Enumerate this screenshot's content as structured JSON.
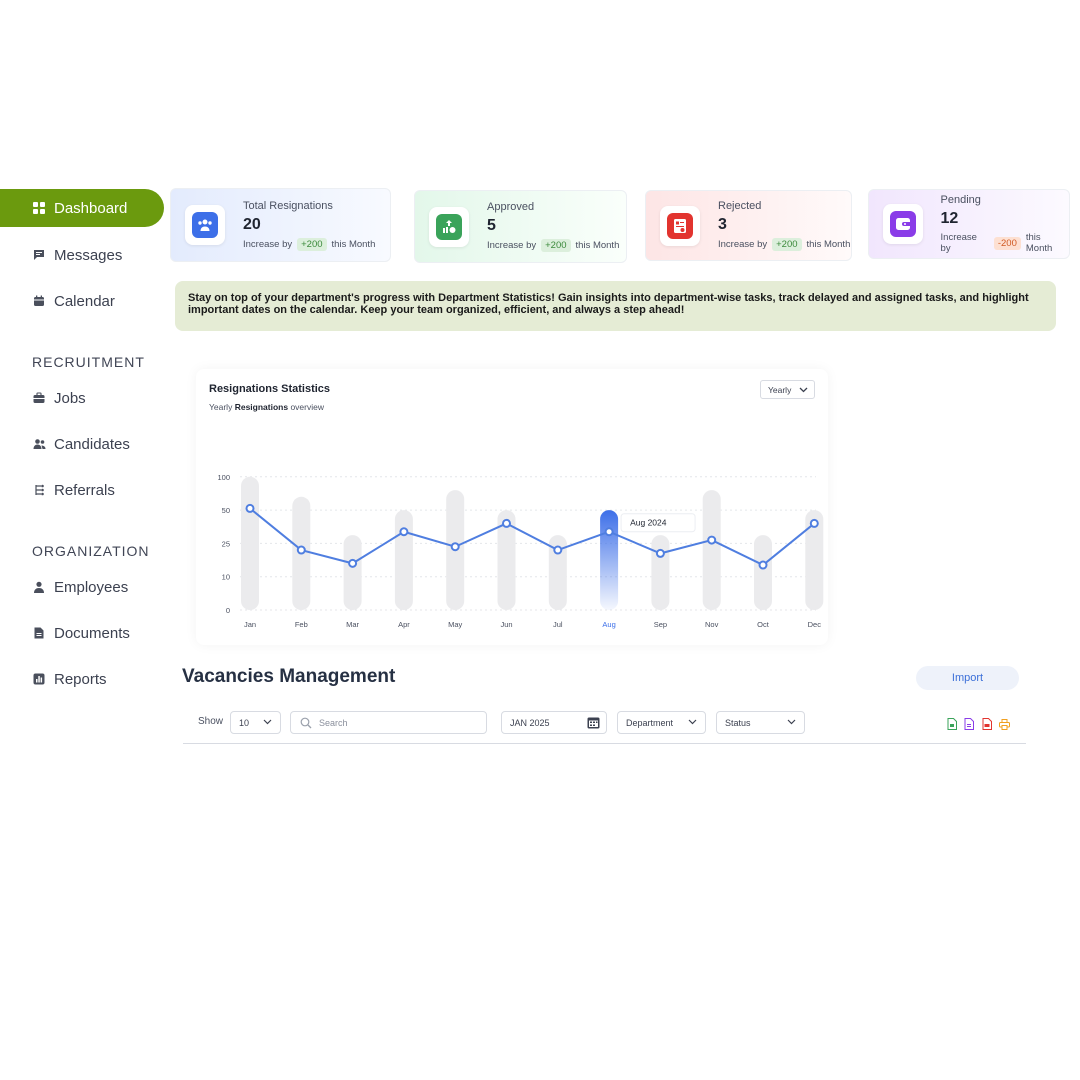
{
  "sidebar": {
    "items": [
      {
        "label": "Dashboard",
        "icon": "grid-icon"
      },
      {
        "label": "Messages",
        "icon": "message-icon"
      },
      {
        "label": "Calendar",
        "icon": "calendar-icon"
      }
    ],
    "recruitment_title": "RECRUITMENT",
    "recruitment_items": [
      {
        "label": "Jobs",
        "icon": "briefcase-icon"
      },
      {
        "label": "Candidates",
        "icon": "users-icon"
      },
      {
        "label": "Referrals",
        "icon": "referral-icon"
      }
    ],
    "organization_title": "ORGANIZATION",
    "organization_items": [
      {
        "label": "Employees",
        "icon": "user-icon"
      },
      {
        "label": "Documents",
        "icon": "document-icon"
      },
      {
        "label": "Reports",
        "icon": "report-icon"
      }
    ]
  },
  "stats": [
    {
      "label": "Total Resignations",
      "value": "20",
      "prefix": "Increase by",
      "delta": "+200",
      "suffix": "this Month",
      "color": "#3d6fe8"
    },
    {
      "label": "Approved",
      "value": "5",
      "prefix": "Increase by",
      "delta": "+200",
      "suffix": "this Month",
      "color": "#3aa35a"
    },
    {
      "label": "Rejected",
      "value": "3",
      "prefix": "Increase by",
      "delta": "+200",
      "suffix": "this Month",
      "color": "#e2342f"
    },
    {
      "label": "Pending",
      "value": "12",
      "prefix": "Increase by",
      "delta": "-200",
      "suffix": "this Month",
      "color": "#8a3ce8"
    }
  ],
  "banner": "Stay on top of your department's progress with Department Statistics! Gain insights into department-wise tasks, track delayed and assigned tasks, and highlight important dates on the calendar. Keep your team organized, efficient, and always a step ahead!",
  "chart_panel": {
    "title": "Resignations Statistics",
    "sub_prefix": "Yearly",
    "sub_bold": "Resignations",
    "sub_suffix": "overview",
    "period": "Yearly",
    "tooltip": "Aug 2024"
  },
  "chart_data": {
    "type": "bar",
    "categories": [
      "Jan",
      "Feb",
      "Mar",
      "Apr",
      "May",
      "Jun",
      "Jul",
      "Aug",
      "Sep",
      "Nov",
      "Oct",
      "Dec"
    ],
    "y_ticks": [
      "0",
      "10",
      "25",
      "50",
      "100"
    ],
    "bar_levels": [
      4,
      3.4,
      2.25,
      3,
      3.6,
      3,
      2.25,
      3,
      2.25,
      3.6,
      2.25,
      3
    ],
    "highlight_index": 7,
    "line_levels": [
      3.05,
      1.8,
      1.4,
      2.35,
      1.9,
      2.6,
      1.8,
      2.35,
      1.7,
      2.1,
      1.35,
      2.6
    ],
    "grid": true,
    "colors": {
      "bar": "#ebebed",
      "highlight": "#3d6fe8",
      "line": "#4f7ee0"
    }
  },
  "vacancies": {
    "title": "Vacancies Management",
    "import_label": "Import",
    "show_label": "Show",
    "show_value": "10",
    "search_placeholder": "Search",
    "date_value": "JAN 2025",
    "department_value": "Department",
    "status_value": "Status",
    "export_icons": [
      {
        "name": "excel-export-icon",
        "color": "#3aa35a"
      },
      {
        "name": "doc-export-icon",
        "color": "#8a3ce8"
      },
      {
        "name": "pdf-export-icon",
        "color": "#e2342f"
      },
      {
        "name": "print-icon",
        "color": "#f0a020"
      }
    ]
  }
}
